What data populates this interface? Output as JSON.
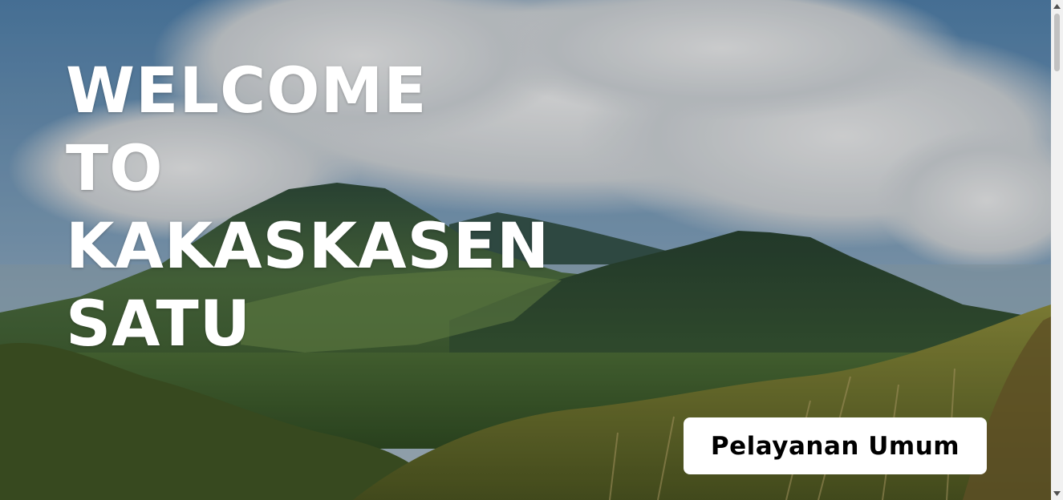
{
  "hero": {
    "title_lines": [
      "WELCOME",
      "TO",
      "KAKASKASEN",
      "SATU"
    ],
    "image": "mountain-landscape"
  },
  "cta": {
    "label": "Pelayanan Umum"
  },
  "scrollbar": {
    "up_icon": "chevron-up-icon",
    "down_icon": "chevron-down-icon"
  },
  "colors": {
    "title": "#ffffff",
    "button_bg": "#ffffff",
    "button_text": "#000000",
    "sky": "#5d87ad",
    "clouds": "#d9dde0",
    "mountains": "#3e5a3a",
    "foliage": "#6b7a2e"
  }
}
